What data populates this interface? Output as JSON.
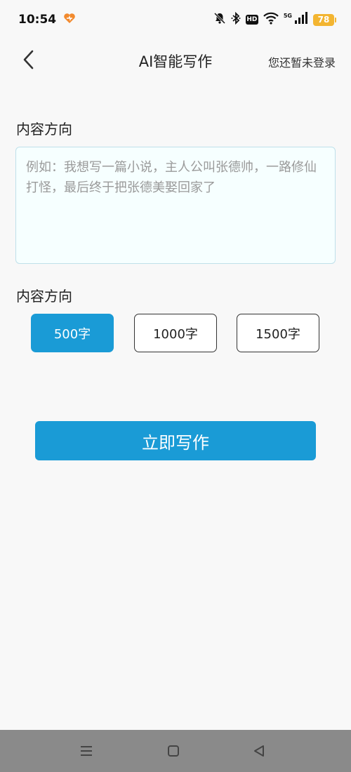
{
  "status_bar": {
    "time": "10:54",
    "network_type": "5G",
    "hd_label": "HD",
    "battery_level": "78",
    "icons": [
      "heart-app-icon",
      "bell-off-icon",
      "bluetooth-icon",
      "hd-icon",
      "wifi-icon",
      "signal-icon",
      "battery-icon"
    ]
  },
  "header": {
    "title": "AI智能写作",
    "login_text": "您还暂未登录",
    "back_icon": "chevron-left-icon"
  },
  "form": {
    "content_section_label": "内容方向",
    "content_placeholder": "例如：我想写一篇小说，主人公叫张德帅，一路修仙打怪，最后终于把张德美娶回家了",
    "content_value": "",
    "length_section_label": "内容方向",
    "length_options": [
      {
        "label": "500字",
        "selected": true
      },
      {
        "label": "1000字",
        "selected": false
      },
      {
        "label": "1500字",
        "selected": false
      }
    ],
    "submit_label": "立即写作"
  },
  "colors": {
    "accent": "#1a9bd6",
    "background": "#f8f8f8",
    "input_background": "#f6ffff",
    "input_border": "#bfe0ea",
    "battery": "#f3b531",
    "nav_bar": "#8a8a8a"
  },
  "nav_bar": {
    "icons": [
      "menu-icon",
      "home-square-icon",
      "back-triangle-icon"
    ]
  }
}
